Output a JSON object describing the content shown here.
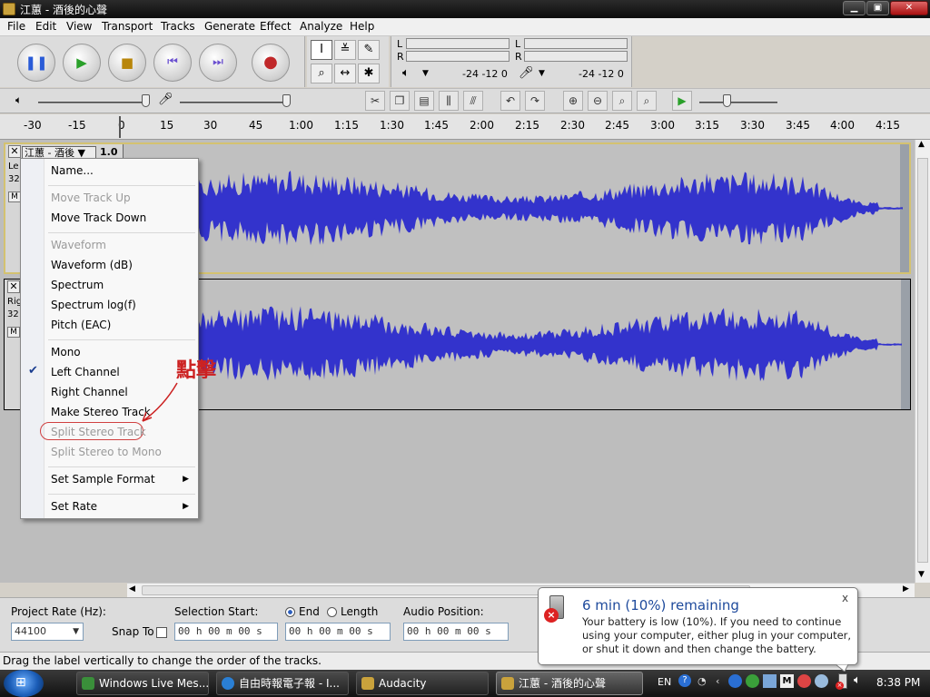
{
  "window": {
    "title": "江蕙 - 酒後的心聲"
  },
  "menubar": {
    "items": [
      "File",
      "Edit",
      "View",
      "Transport",
      "Tracks",
      "Generate",
      "Effect",
      "Analyze",
      "Help"
    ]
  },
  "meters": {
    "left_label": "L",
    "right_label": "R",
    "play_scale": "-24 -12 0",
    "rec_scale": "-24 -12 0"
  },
  "ruler": {
    "ticks": [
      "-30",
      "-15",
      "0",
      "15",
      "30",
      "45",
      "1:00",
      "1:15",
      "1:30",
      "1:45",
      "2:00",
      "2:15",
      "2:30",
      "2:45",
      "3:00",
      "3:15",
      "3:30",
      "3:45",
      "4:00",
      "4:15"
    ]
  },
  "track": {
    "name": "江蕙 - 酒後",
    "scale": "1.0",
    "left_label": "Le",
    "left_rate": "32",
    "right_label": "Rig",
    "right_rate": "32",
    "m": "M"
  },
  "context_menu": {
    "items": [
      {
        "label": "Name...",
        "disabled": false
      },
      {
        "label": "Move Track Up",
        "disabled": true
      },
      {
        "label": "Move Track Down",
        "disabled": false
      },
      {
        "label": "Waveform",
        "disabled": true
      },
      {
        "label": "Waveform (dB)",
        "disabled": false
      },
      {
        "label": "Spectrum",
        "disabled": false
      },
      {
        "label": "Spectrum log(f)",
        "disabled": false
      },
      {
        "label": "Pitch (EAC)",
        "disabled": false
      },
      {
        "label": "Mono",
        "disabled": false
      },
      {
        "label": "Left Channel",
        "disabled": false,
        "checked": true
      },
      {
        "label": "Right Channel",
        "disabled": false
      },
      {
        "label": "Make Stereo Track",
        "disabled": false
      },
      {
        "label": "Split Stereo Track",
        "disabled": true
      },
      {
        "label": "Split Stereo to Mono",
        "disabled": true
      },
      {
        "label": "Set Sample Format",
        "disabled": false,
        "submenu": true
      },
      {
        "label": "Set Rate",
        "disabled": false,
        "submenu": true
      }
    ]
  },
  "annotation": {
    "text": "點擊",
    "color": "#cc2222"
  },
  "selection_bar": {
    "project_rate_label": "Project Rate (Hz):",
    "project_rate_value": "44100",
    "snap_to_label": "Snap To",
    "selection_start_label": "Selection Start:",
    "end_label": "End",
    "length_label": "Length",
    "audio_position_label": "Audio Position:",
    "time_value": "00 h 00 m 00 s"
  },
  "statusbar": {
    "text": "Drag the label vertically to change the order of the tracks."
  },
  "balloon": {
    "title": "6 min (10%) remaining",
    "body": "Your battery is low (10%). If you need to continue using your computer, either plug in your computer, or shut it down and then change the battery.",
    "close": "x"
  },
  "taskbar": {
    "items": [
      "Windows Live Mes...",
      "自由時報電子報 - I...",
      "Audacity",
      "江蕙 - 酒後的心聲"
    ],
    "lang": "EN",
    "clock": "8:38 PM"
  },
  "colors": {
    "waveform": "#3333cc",
    "waveform_bg": "#c0c0c0",
    "selected_track_border": "#d4c270"
  }
}
